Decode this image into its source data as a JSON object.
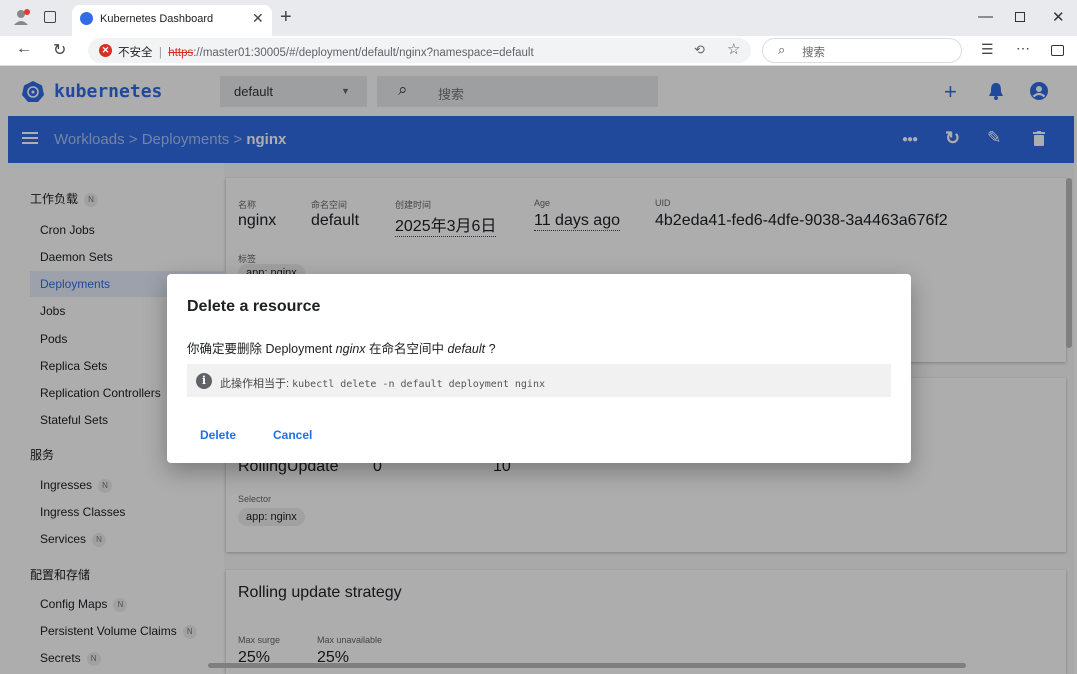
{
  "browser": {
    "tab_title": "Kubernetes Dashboard",
    "url_warning": "不安全",
    "url_scheme": "https",
    "url_rest": "://master01:30005/#/deployment/default/nginx?namespace=default",
    "search_placeholder": "搜索"
  },
  "header": {
    "brand": "kubernetes",
    "namespace": "default",
    "search_placeholder": "搜索"
  },
  "breadcrumb": {
    "workloads": "Workloads",
    "deployments": "Deployments",
    "current": "nginx",
    "sep1": ">",
    "sep2": ">"
  },
  "sidebar": {
    "workloads_title": "工作负载",
    "workloads_items": [
      "Cron Jobs",
      "Daemon Sets",
      "Deployments",
      "Jobs",
      "Pods",
      "Replica Sets",
      "Replication Controllers",
      "Stateful Sets"
    ],
    "service_title": "服务",
    "service_items": [
      "Ingresses",
      "Ingress Classes",
      "Services"
    ],
    "config_title": "配置和存储",
    "config_items": [
      "Config Maps",
      "Persistent Volume Claims",
      "Secrets"
    ],
    "badge": "N"
  },
  "metadata": {
    "name_label": "名称",
    "name": "nginx",
    "ns_label": "命名空间",
    "ns": "default",
    "created_label": "创建时间",
    "created": "2025年3月6日",
    "age_label": "Age",
    "age": "11 days ago",
    "uid_label": "UID",
    "uid": "4b2eda41-fed6-4dfe-9038-3a4463a676f2",
    "labels_label": "标签",
    "label_chip": "app: nginx"
  },
  "resource": {
    "strategy": "RollingUpdate",
    "min_ready": "0",
    "revision_limit": "10",
    "selector_label": "Selector",
    "selector": "app: nginx"
  },
  "rolling": {
    "title": "Rolling update strategy",
    "max_surge_label": "Max surge",
    "max_surge": "25%",
    "max_unavail_label": "Max unavailable",
    "max_unavail": "25%"
  },
  "dialog": {
    "title": "Delete a resource",
    "q_prefix": "你确定要删除 Deployment",
    "q_name": "nginx",
    "q_mid": "在命名空间中",
    "q_ns": "default",
    "q_end": "?",
    "info_label": "此操作相当于:",
    "info_cmd": "kubectl delete -n default deployment nginx",
    "delete": "Delete",
    "cancel": "Cancel"
  },
  "colors": {
    "brand_blue": "#326ce5",
    "link_blue": "#1a73e8",
    "warning_red": "#d93025"
  }
}
